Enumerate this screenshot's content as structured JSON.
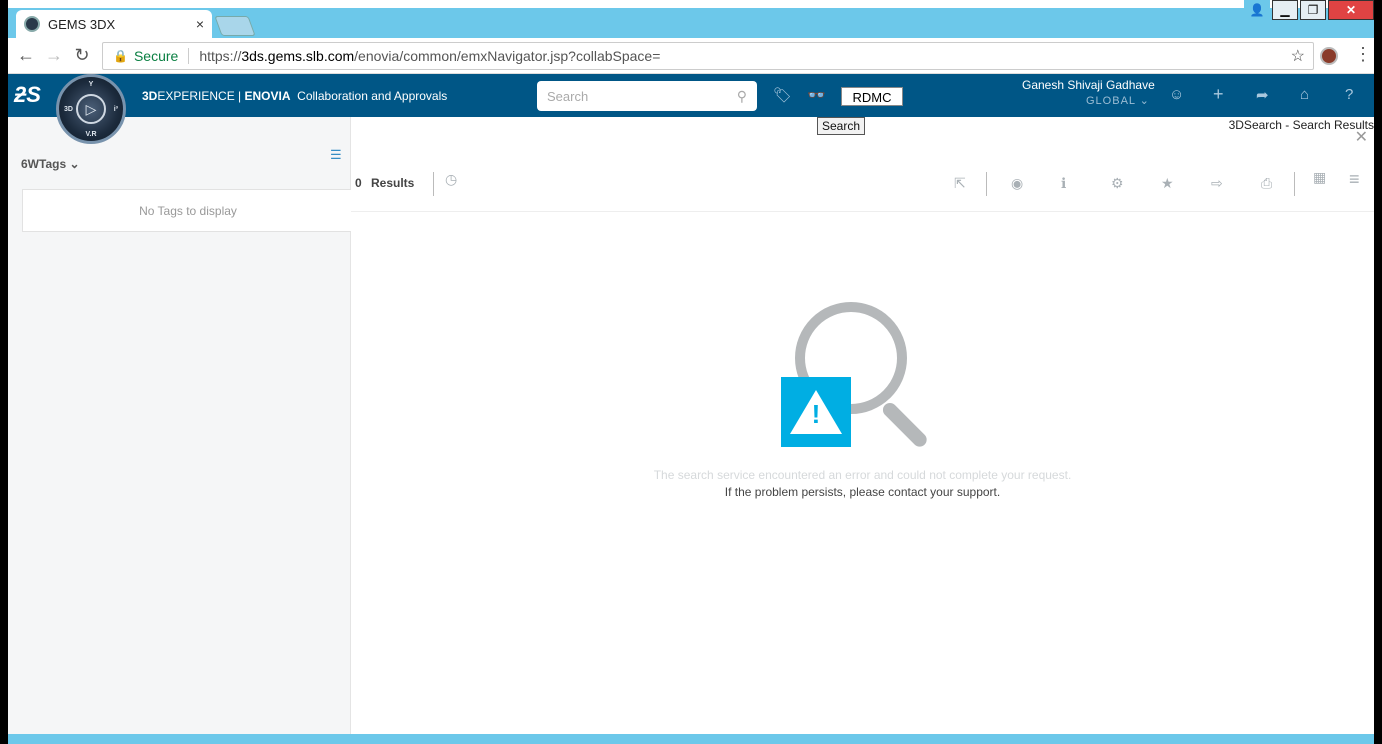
{
  "browser": {
    "tab_title": "GEMS 3DX",
    "tab_close": "×",
    "secure_label": "Secure",
    "url_scheme": "https://",
    "url_host": "3ds.gems.slb.com",
    "url_path": "/enovia/common/emxNavigator.jsp?collabSpace=",
    "back": "←",
    "forward": "→",
    "reload": "↻",
    "bookmark_star": "☆",
    "menu": "⋮",
    "window_controls": {
      "user": "👤",
      "minimize": "▁",
      "restore": "❐",
      "close": "✕"
    }
  },
  "app_header": {
    "ds_logo": "ƻS",
    "compass": {
      "center": "▷",
      "top": "Y",
      "left": "3D",
      "right": "i³",
      "bottom": "V.R"
    },
    "brand_bold": "3D",
    "brand_rest": "EXPERIENCE | ",
    "brand_product": "ENOVIA",
    "brand_app": "Collaboration and Approvals",
    "search_placeholder": "Search",
    "search_icon": "⚲",
    "tag_icon": "🏷",
    "binoculars_icon": "👓",
    "rdmc_label": "RDMC",
    "tooltip": "Search",
    "user_name": "Ganesh Shivaji Gadhave",
    "user_group": "GLOBAL ⌄",
    "icons": {
      "profile": "☺",
      "add": "+",
      "share": "➦",
      "home": "⌂",
      "help": "?"
    }
  },
  "tags_panel": {
    "title": "6WTags ⌄",
    "filter_icon": "☰",
    "empty_message": "No Tags to display"
  },
  "results_panel": {
    "title": "3DSearch - Search Results",
    "close": "✕",
    "count": "0",
    "results_label": "Results",
    "history_icon": "◷",
    "toolbar_icons": {
      "select": "⇱",
      "view": "◉",
      "info": "ℹ",
      "settings": "⚙",
      "favorite": "★",
      "export": "⇨",
      "print": "⎙",
      "grid": "▦",
      "menu": "≡"
    },
    "warning_mark": "!",
    "error_line1": "The search service encountered an error and could not complete your request.",
    "error_line2": "If the problem persists, please contact your support."
  }
}
